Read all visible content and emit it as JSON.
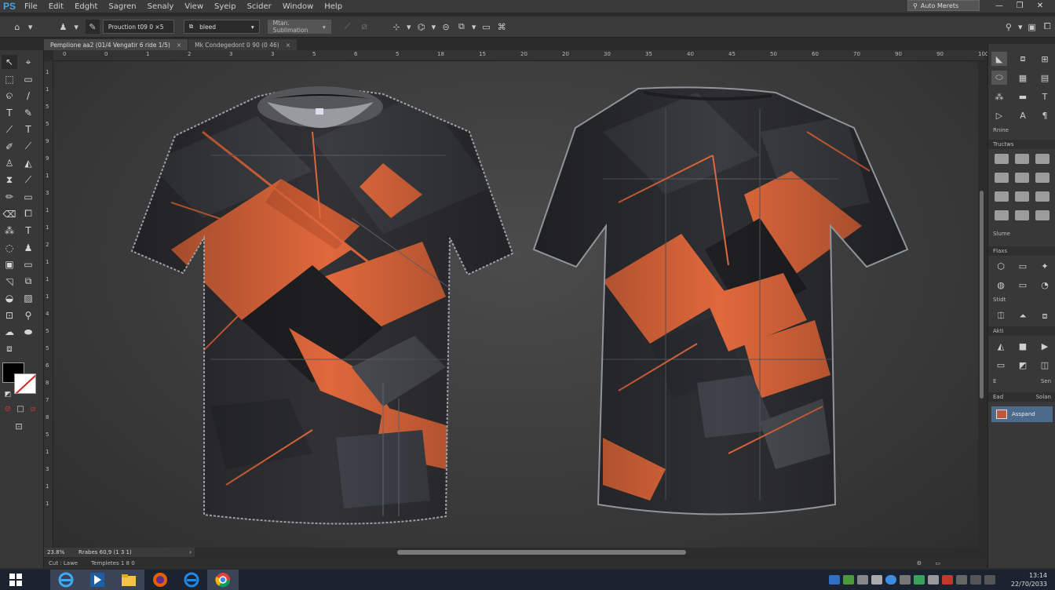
{
  "menubar": {
    "logo": "PS",
    "items": [
      "File",
      "Edit",
      "Edght",
      "Sagren",
      "Senaly",
      "View",
      "Syeip",
      "Scider",
      "Window",
      "Help"
    ],
    "search_label": "Auto Merets",
    "win_minimize": "—",
    "win_restore": "❐",
    "win_close": "✕"
  },
  "options": {
    "preset_label": "Prouction",
    "preset_value": "t09 0 ×5",
    "bleed_label": "bleed",
    "mode_label": "Mtan. Sublimation",
    "icons": [
      "move-tool-icon",
      "align-icon",
      "transform-icon",
      "rotate-icon",
      "arrange-icon",
      "frame-icon"
    ]
  },
  "tabs": [
    {
      "label": "Pemplione aa2 (01/4 Vengatir 6 ride 1/5)",
      "active": true,
      "close": "×"
    },
    {
      "label": "Mk Condegedont 0 90 (0 46)",
      "active": false,
      "close": "×"
    }
  ],
  "ruler": {
    "h_ticks": [
      "0",
      "0",
      "1",
      "2",
      "3",
      "3",
      "5",
      "6",
      "5",
      "18",
      "15",
      "20",
      "20",
      "30",
      "35",
      "40",
      "45",
      "50",
      "60",
      "70",
      "90",
      "90",
      "100"
    ],
    "v_ticks": [
      "1",
      "1",
      "5",
      "5",
      "9",
      "9",
      "1",
      "3",
      "1",
      "1",
      "2",
      "1",
      "1",
      "1",
      "4",
      "5",
      "5",
      "6",
      "8",
      "7",
      "8",
      "5",
      "1",
      "3",
      "1",
      "1"
    ]
  },
  "tools": [
    {
      "name": "move-tool",
      "glyph": "↖"
    },
    {
      "name": "artboard-tool",
      "glyph": "⌖"
    },
    {
      "name": "marquee-tool",
      "glyph": "⬚"
    },
    {
      "name": "rect-select-tool",
      "glyph": "▭"
    },
    {
      "name": "lasso-tool",
      "glyph": "ଚ"
    },
    {
      "name": "brush-tool",
      "glyph": "∕"
    },
    {
      "name": "type-tool",
      "glyph": "T"
    },
    {
      "name": "pen-tool",
      "glyph": "✎"
    },
    {
      "name": "eyedropper-tool",
      "glyph": "⟋"
    },
    {
      "name": "type-vertical-tool",
      "glyph": "T"
    },
    {
      "name": "healing-tool",
      "glyph": "✐"
    },
    {
      "name": "clone-tool",
      "glyph": "⟋"
    },
    {
      "name": "stamp-tool",
      "glyph": "♙"
    },
    {
      "name": "fill-tool",
      "glyph": "◭"
    },
    {
      "name": "hourglass-tool",
      "glyph": "⧗"
    },
    {
      "name": "smudge-tool",
      "glyph": "⟋"
    },
    {
      "name": "pencil-tool",
      "glyph": "✏"
    },
    {
      "name": "shape-tool",
      "glyph": "▭"
    },
    {
      "name": "eraser-tool",
      "glyph": "⌫"
    },
    {
      "name": "crop-tool",
      "glyph": "⧠"
    },
    {
      "name": "pattern-tool",
      "glyph": "⁂"
    },
    {
      "name": "text-tool",
      "glyph": "T"
    },
    {
      "name": "dodge-tool",
      "glyph": "◌"
    },
    {
      "name": "burn-tool",
      "glyph": "♟"
    },
    {
      "name": "frame-tool",
      "glyph": "▣"
    },
    {
      "name": "path-tool",
      "glyph": "▭"
    },
    {
      "name": "blur-tool",
      "glyph": "◹"
    },
    {
      "name": "slice-tool",
      "glyph": "⧉"
    },
    {
      "name": "sponge-tool",
      "glyph": "◒"
    },
    {
      "name": "ruler-tool",
      "glyph": "▨"
    },
    {
      "name": "note-tool",
      "glyph": "⊡"
    },
    {
      "name": "zoom-tool",
      "glyph": "⚲"
    },
    {
      "name": "hand-tool",
      "glyph": "☁"
    },
    {
      "name": "rotate-view-tool",
      "glyph": "⬬"
    },
    {
      "name": "extras-tool",
      "glyph": "⧈"
    }
  ],
  "colors": {
    "foreground": "#000000",
    "background": "#ffffff",
    "accent_orange": "#e0683c",
    "shirt_dark": "#2a2a2d"
  },
  "status": {
    "zoom": "23.8%",
    "doc_info": "Rrabes 60,9 (1 3 1)",
    "left_info": "Cut : Lawe",
    "right_info": "Templetes 1 8 0"
  },
  "panels": {
    "top_section_label": "Rnine",
    "swatches_title": "Tructws",
    "shapes_label": "Slume",
    "styles_title": "Flaxs",
    "sizes_label": "Stidt",
    "adjust_title": "Akti",
    "row_left": "E",
    "row_right": "Sen",
    "layers_tab_left": "Ead",
    "layers_tab_right": "Solan",
    "layer_name": "Asspand"
  },
  "taskbar": {
    "apps": [
      "windows-start",
      "internet-explorer",
      "photoshop",
      "file-explorer",
      "firefox",
      "edge",
      "chrome"
    ],
    "time": "13:14",
    "date": "22/70/2033"
  }
}
